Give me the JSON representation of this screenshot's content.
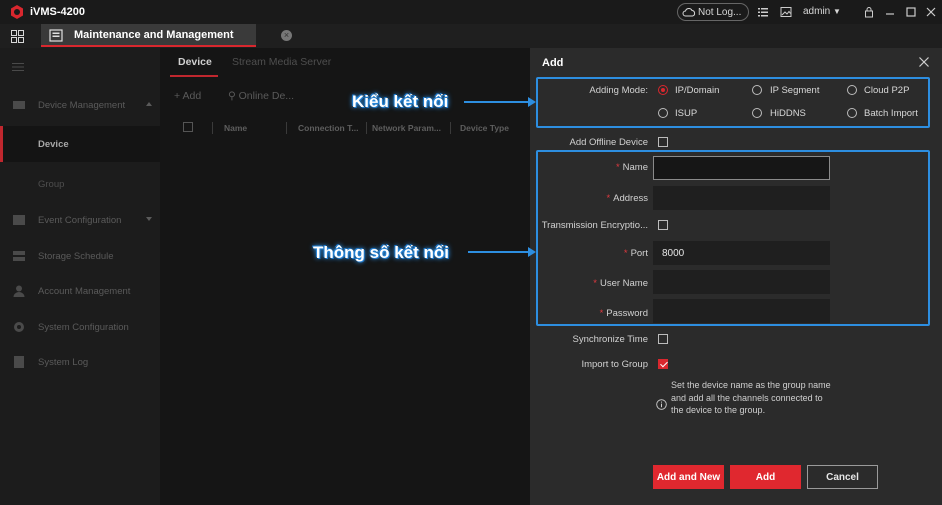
{
  "app": {
    "name": "iVMS-4200",
    "cloud_status": "Not Log...",
    "user": "admin"
  },
  "tabs": {
    "main_tab": "Maintenance and Management"
  },
  "sidebar": {
    "items": [
      {
        "label": "Device Management",
        "icon": "device-icon"
      },
      {
        "label": "Device",
        "active": true
      },
      {
        "label": "Group"
      },
      {
        "label": "Event Configuration",
        "icon": "event-icon"
      },
      {
        "label": "Storage Schedule",
        "icon": "storage-icon"
      },
      {
        "label": "Account Management",
        "icon": "account-icon"
      },
      {
        "label": "System Configuration",
        "icon": "gear-icon"
      },
      {
        "label": "System Log",
        "icon": "log-icon"
      }
    ]
  },
  "main": {
    "subtabs": [
      "Device",
      "Stream Media Server"
    ],
    "toolbar": {
      "add": "Add",
      "online": "Online De..."
    },
    "columns": [
      "Name",
      "Connection T...",
      "Network Param...",
      "Device Type"
    ]
  },
  "dialog": {
    "title": "Add",
    "adding_mode_label": "Adding Mode:",
    "modes": [
      "IP/Domain",
      "IP Segment",
      "Cloud P2P",
      "ISUP",
      "HiDDNS",
      "Batch Import"
    ],
    "selected_mode": "IP/Domain",
    "add_offline_label": "Add Offline Device",
    "fields": {
      "name_label": "Name",
      "name_value": "",
      "address_label": "Address",
      "address_value": "",
      "encryption_label": "Transmission Encryptio...",
      "port_label": "Port",
      "port_value": "8000",
      "username_label": "User Name",
      "username_value": "",
      "password_label": "Password",
      "password_value": ""
    },
    "sync_time_label": "Synchronize Time",
    "import_group_label": "Import to Group",
    "import_group_checked": true,
    "hint": "Set the device name as the group name and add all the channels connected to the device to the group.",
    "buttons": {
      "add_new": "Add and New",
      "add": "Add",
      "cancel": "Cancel"
    }
  },
  "annotations": {
    "mode": "Kiểu kết nối",
    "params": "Thông số kết nối"
  },
  "colors": {
    "accent": "#d9272e",
    "annotation_blue": "#2d8ee0",
    "dialog_bg": "#2b2b2b"
  }
}
